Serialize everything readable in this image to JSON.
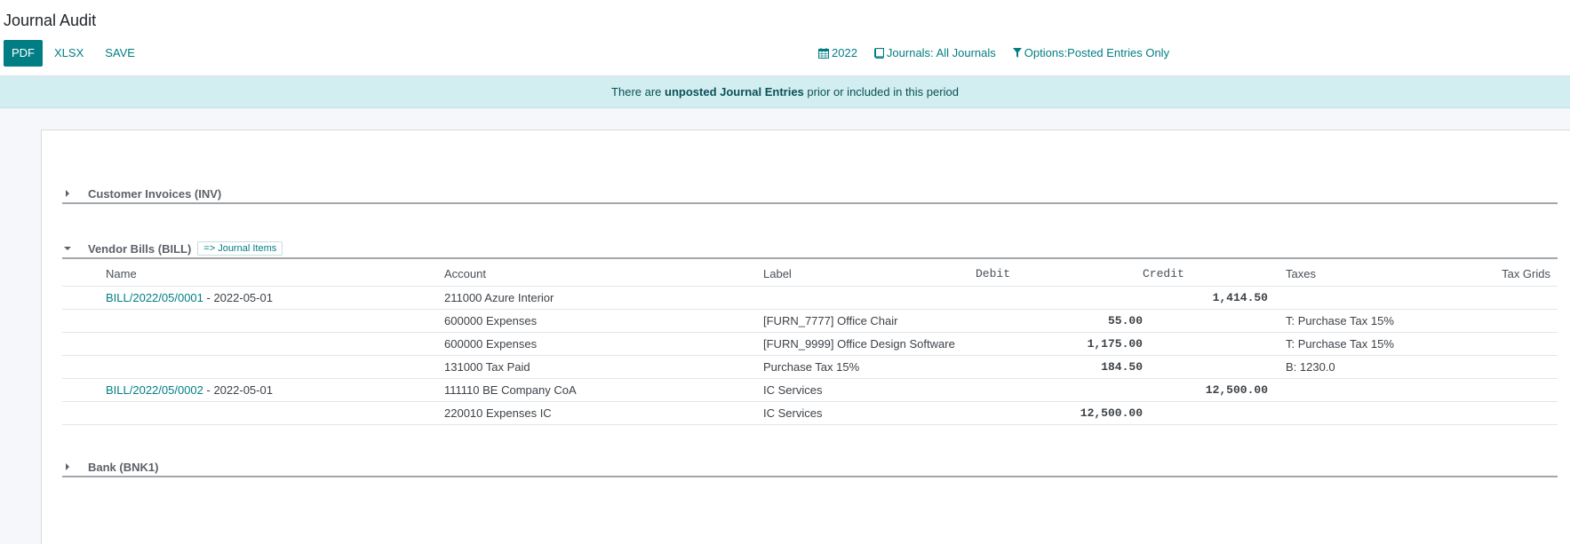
{
  "header": {
    "title": "Journal Audit"
  },
  "toolbar": {
    "pdf": "PDF",
    "xlsx": "XLSX",
    "save": "SAVE"
  },
  "filters": {
    "date": "2022",
    "journals": "Journals: All Journals",
    "options": "Options:Posted Entries Only"
  },
  "alert": {
    "prefix": "There are ",
    "strong": "unposted Journal Entries",
    "suffix": " prior or included in this period"
  },
  "journals": [
    {
      "name": "Customer Invoices (INV)",
      "expanded": false
    },
    {
      "name": "Vendor Bills (BILL)",
      "expanded": true,
      "link": "=> Journal Items"
    },
    {
      "name": "Bank (BNK1)",
      "expanded": false
    }
  ],
  "table": {
    "columns": [
      "Name",
      "Account",
      "Label",
      "Debit",
      "Credit",
      "Taxes",
      "Tax Grids"
    ],
    "rows": [
      {
        "move": "BILL/2022/05/0001",
        "date": " - 2022-05-01",
        "account": "211000 Azure Interior",
        "label": "",
        "debit": "",
        "credit": "1,414.50",
        "taxes": "",
        "grids": ""
      },
      {
        "move": "",
        "date": "",
        "account": "600000 Expenses",
        "label": "[FURN_7777] Office Chair",
        "debit": "55.00",
        "credit": "",
        "taxes": "T: Purchase Tax 15%",
        "grids": ""
      },
      {
        "move": "",
        "date": "",
        "account": "600000 Expenses",
        "label": "[FURN_9999] Office Design Software",
        "debit": "1,175.00",
        "credit": "",
        "taxes": "T: Purchase Tax 15%",
        "grids": ""
      },
      {
        "move": "",
        "date": "",
        "account": "131000 Tax Paid",
        "label": "Purchase Tax 15%",
        "debit": "184.50",
        "credit": "",
        "taxes": "B: 1230.0",
        "grids": ""
      },
      {
        "move": "BILL/2022/05/0002",
        "date": " - 2022-05-01",
        "account": "111110 BE Company CoA",
        "label": "IC Services",
        "debit": "",
        "credit": "12,500.00",
        "taxes": "",
        "grids": ""
      },
      {
        "move": "",
        "date": "",
        "account": "220010 Expenses IC",
        "label": "IC Services",
        "debit": "12,500.00",
        "credit": "",
        "taxes": "",
        "grids": ""
      }
    ]
  },
  "colors": {
    "primary": "#017e84",
    "alert_bg": "#d2eef1",
    "content_bg": "#f6f7fa"
  }
}
